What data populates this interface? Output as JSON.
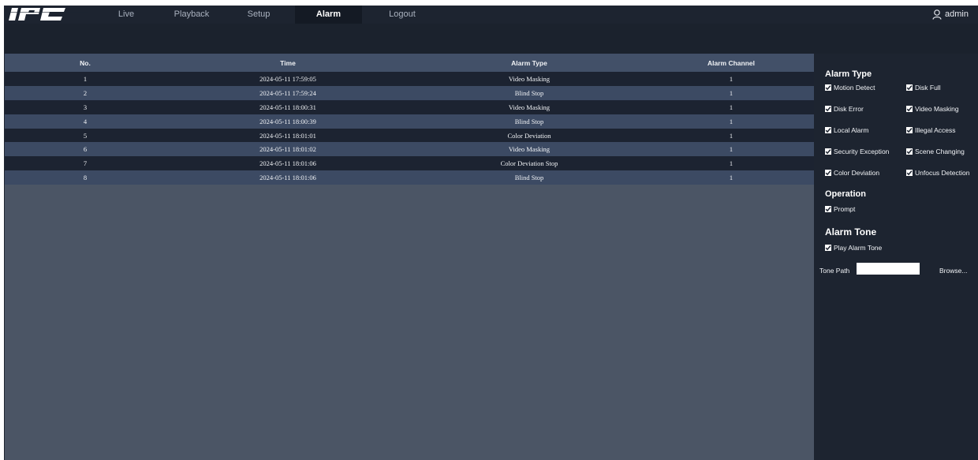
{
  "header": {
    "logo_text": "IPC",
    "nav": [
      "Live",
      "Playback",
      "Setup",
      "Alarm",
      "Logout"
    ],
    "active_tab": "Alarm",
    "user_name": "admin"
  },
  "table": {
    "columns": [
      "No.",
      "Time",
      "Alarm Type",
      "Alarm Channel"
    ],
    "rows": [
      [
        "1",
        "2024-05-11 17:59:05",
        "Video Masking",
        "1"
      ],
      [
        "2",
        "2024-05-11 17:59:24",
        "Blind Stop",
        "1"
      ],
      [
        "3",
        "2024-05-11 18:00:31",
        "Video Masking",
        "1"
      ],
      [
        "4",
        "2024-05-11 18:00:39",
        "Blind Stop",
        "1"
      ],
      [
        "5",
        "2024-05-11 18:01:01",
        "Color Deviation",
        "1"
      ],
      [
        "6",
        "2024-05-11 18:01:02",
        "Video Masking",
        "1"
      ],
      [
        "7",
        "2024-05-11 18:01:06",
        "Color Deviation Stop",
        "1"
      ],
      [
        "8",
        "2024-05-11 18:01:06",
        "Blind Stop",
        "1"
      ]
    ]
  },
  "side": {
    "alarm_type_title": "Alarm Type",
    "alarm_types": [
      "Motion Detect",
      "Disk Full",
      "Disk Error",
      "Video Masking",
      "Local Alarm",
      "Illegal Access",
      "Security Exception",
      "Scene Changing",
      "Color Deviation",
      "Unfocus Detection"
    ],
    "operation_title": "Operation",
    "operation_label": "Prompt",
    "alarm_tone_title": "Alarm Tone",
    "play_tone_label": "Play Alarm Tone",
    "tone_path_label": "Tone Path",
    "tone_path_value": "",
    "browse_label": "Browse..."
  },
  "colors": {
    "header_bg": "#1d2430",
    "table_header_bg": "#425068",
    "row_dark": "#1c2331",
    "row_light": "#3c4a63",
    "content_bg": "#4b5565"
  }
}
